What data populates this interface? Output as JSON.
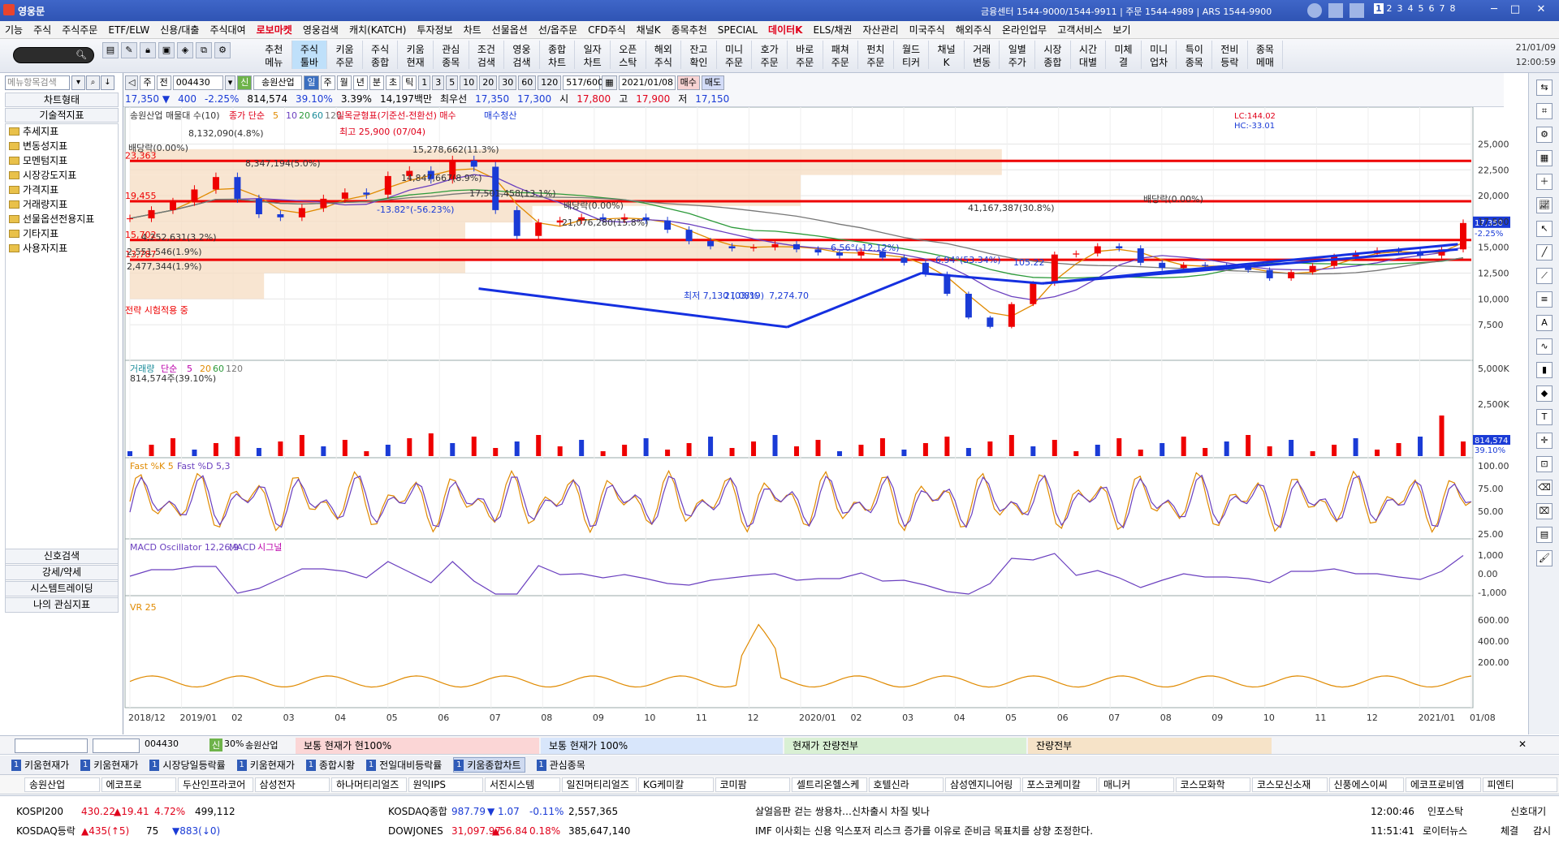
{
  "window": {
    "title": "영웅문",
    "info": "금융센터 1544-9000/1544-9911 | 주문 1544-4989 | ARS 1544-9900",
    "workspaces": [
      "1",
      "2",
      "3",
      "4",
      "5",
      "6",
      "7",
      "8"
    ]
  },
  "menu": [
    "기능",
    "주식",
    "주식주문",
    "ETF/ELW",
    "신용/대출",
    "주식대여",
    "로보마켓",
    "영웅검색",
    "캐치(KATCH)",
    "투자정보",
    "차트",
    "선물옵션",
    "선/옵주문",
    "CFD주식",
    "채널K",
    "종목추천",
    "SPECIAL",
    "데이터K",
    "ELS/채권",
    "자산관리",
    "미국주식",
    "해외주식",
    "온라인업무",
    "고객서비스",
    "보기"
  ],
  "toolbar": {
    "buttons": [
      "추천\n메뉴",
      "주식\n툴바",
      "키움\n주문",
      "주식\n종합",
      "키움\n현재",
      "관심\n종목",
      "조건\n검색",
      "영웅\n검색",
      "종합\n차트",
      "일자\n차트",
      "오픈\n스탁",
      "해외\n주식",
      "잔고\n확인",
      "미니\n주문",
      "호가\n주문",
      "바로\n주문",
      "패쳐\n주문",
      "펀치\n주문",
      "월드\n티커",
      "채널\nK",
      "거래\n변동",
      "일별\n주가",
      "시장\n종합",
      "시간\n대별",
      "미체\n결",
      "미니\n업차",
      "특이\n종목",
      "전비\n등락",
      "종목\n메매"
    ],
    "date": "21/01/09",
    "time": "12:00:59"
  },
  "left": {
    "search_placeholder": "메뉴항목검색",
    "head1": "차트형태",
    "head2": "기술적지표",
    "items": [
      "추세지표",
      "변동성지표",
      "모멘텀지표",
      "시장강도지표",
      "가격지표",
      "거래량지표",
      "선물옵션전용지표",
      "기타지표",
      "사용자지표"
    ],
    "footer": [
      "신호검색",
      "강세/약세",
      "시스템트레이딩",
      "나의 관심지표"
    ]
  },
  "ctrl": {
    "code": "004430",
    "name": "송원산업",
    "periods": [
      "일",
      "주",
      "월",
      "년",
      "분",
      "초",
      "틱"
    ],
    "nums": [
      "1",
      "3",
      "5",
      "10",
      "20",
      "30",
      "60",
      "120"
    ],
    "count": "517/600",
    "date": "2021/01/08",
    "buy": "매수",
    "sell": "매도",
    "price": "17,350",
    "arrow": "▼",
    "change": "400",
    "rate": "-2.25%",
    "volume": "814,574",
    "vol_rate": "39.10%",
    "turnover": "3.39%",
    "amount": "14,197백만",
    "bid_label": "최우선",
    "bid": "17,350",
    "ask": "17,300",
    "open_label": "시",
    "open": "17,800",
    "high_label": "고",
    "high": "17,900",
    "low_label": "저",
    "low": "17,150"
  },
  "chart_data": {
    "type": "line",
    "title": "송원산업 매물대 수(10)",
    "price_legend": {
      "ma": "종가 단순",
      "periods": [
        "5",
        "10",
        "20",
        "60",
        "120"
      ]
    },
    "ichimoku": "일목균형표(기준선-전환선) 매수",
    "buy_signal": "매수청산",
    "lc": "LC:144.02",
    "hc": "HC:-33.01",
    "x_ticks": [
      "2018/12",
      "2019/01",
      "02",
      "03",
      "04",
      "05",
      "06",
      "07",
      "08",
      "09",
      "10",
      "11",
      "12",
      "2020/01",
      "02",
      "03",
      "04",
      "05",
      "06",
      "07",
      "08",
      "09",
      "10",
      "11",
      "12",
      "2021/01",
      "01/08"
    ],
    "y_ticks": [
      "25,000",
      "22,500",
      "20,000",
      "17,500",
      "15,000",
      "12,500",
      "10,000",
      "7,500"
    ],
    "close": [
      17800,
      18600,
      19400,
      20600,
      21800,
      19700,
      18200,
      17900,
      18800,
      19700,
      20300,
      20100,
      21900,
      22400,
      21600,
      23400,
      22800,
      18600,
      16100,
      17400,
      17600,
      17900,
      17700,
      17900,
      17600,
      16700,
      15600,
      15100,
      14900,
      15000,
      15300,
      14800,
      14500,
      14200,
      14600,
      14000,
      13500,
      12400,
      10500,
      8200,
      7300,
      9500,
      11500,
      14300,
      14400,
      15100,
      14900,
      13500,
      13000,
      13300,
      13200,
      13100,
      12800,
      12000,
      12600,
      13200,
      14100,
      14400,
      14700,
      14600,
      14200,
      14800,
      17350
    ],
    "close_range": {
      "from": "2018/12",
      "to": "2021/01/08"
    },
    "resistance_levels": [
      "23,363",
      "19,455",
      "15,702",
      "13,787"
    ],
    "volume_profile": [
      "배당락(0.00%)",
      "8,132,090(4.8%)",
      "8,347,194(5.0%)",
      "15,278,662(11.3%)",
      "14,847,667(8.9%)",
      "17,501,458(13.1%)",
      "21,076,280(15.8%)",
      "41,167,387(30.8%)",
      "4,252,631(3.2%)",
      "2,551,546(1.9%)",
      "2,477,344(1.9%)"
    ],
    "annotations": {
      "high": "최고 25,900 (07/04)",
      "low": "최저 7,130 (03/19)",
      "low_price": "7,274.70",
      "dividend": "배당락(0.00%)",
      "dividend2": "배당락(0.00%)",
      "trend1": "-13.82°(-56.23%)",
      "trend2": "6.56°(-12.12%)",
      "trend3": "6.94°(53.34%)",
      "low2": "105.22",
      "pct_low": "21.08%",
      "strategy": "전략 시험적용 중"
    },
    "current_price": "17,350",
    "current_rate": "-2.25%",
    "volume_panel": {
      "title": "거래량",
      "ma": "단순",
      "periods": [
        "5",
        "20",
        "60",
        "120"
      ],
      "current": "814,574주(39.10%)",
      "ticks": [
        "5,000K",
        "2,500K"
      ],
      "current_label": "814,574",
      "rate_label": "39.10%"
    },
    "stoch_panel": {
      "title": "Fast %K 5",
      "d": "Fast %D 5,3",
      "ticks": [
        "100.00",
        "75.00",
        "50.00",
        "25.00"
      ]
    },
    "macd_panel": {
      "title": "MACD Oscillator 12,26,9",
      "macd": "MACD",
      "signal": "시그널",
      "ticks": [
        "1,000",
        "0.00",
        "-1,000"
      ]
    },
    "vr_panel": {
      "title": "VR 25",
      "ticks": [
        "600.00",
        "400.00",
        "200.00"
      ]
    }
  },
  "orderbar": {
    "code": "004430",
    "name": "송원산업",
    "pct": "30%",
    "sec1": "보통 현재가 현100%",
    "sec2": "보통 현재가 100%",
    "sec3": "현재가 잔량전부",
    "sec4": "잔량전부"
  },
  "tabs": [
    "키움현재가",
    "키움현재가",
    "시장당일등락률",
    "키움현재가",
    "종합시황",
    "전일대비등락률",
    "키움종합차트",
    "관심종목"
  ],
  "stocks": [
    "송원산업",
    "에코프로",
    "두산인프라코어",
    "삼성전자",
    "하나머티리얼즈",
    "원익IPS",
    "서진시스템",
    "일진머티리얼즈",
    "KG케미칼",
    "코미팜",
    "셀트리온헬스케",
    "호텔신라",
    "삼성엔지니어링",
    "포스코케미칼",
    "매니커",
    "코스모화학",
    "코스모신소재",
    "신풍에스이씨",
    "에코프로비엠",
    "피엔티"
  ],
  "ticker": {
    "kospi_label": "KOSPI200",
    "kospi": "430.22",
    "kospi_ch": "▲19.41",
    "kospi_rate": "4.72%",
    "kospi_vol": "499,112",
    "kosdaq_label": "KOSDAQ종합",
    "kosdaq": "987.79",
    "kosdaq_ch": "▼ 1.07",
    "kosdaq_rate": "-0.11%",
    "kosdaq_vol": "2,557,365",
    "kosdaq_up_label": "KOSDAQ등락",
    "kosdaq_up": "▲435(↑5)",
    "kosdaq_flat": "75",
    "kosdaq_down": "▼883(↓0)",
    "dow_label": "DOWJONES",
    "dow": "31,097.97",
    "dow_ch": "▲56.84",
    "dow_rate": "0.18%",
    "dow_vol": "385,647,140",
    "news1": "살얼음판 걷는 쌍용차…신차출시 차질 빚나",
    "news2": "IMF 이사회는 신용 익스포저 리스크 증가를 이유로 준비금 목표치를 상향 조정한다.",
    "time1": "12:00:46",
    "src1": "인포스탁",
    "time2": "11:51:41",
    "src2": "로이터뉴스",
    "signal": "신호대기",
    "signal2": "체결",
    "signal3": "감시"
  }
}
